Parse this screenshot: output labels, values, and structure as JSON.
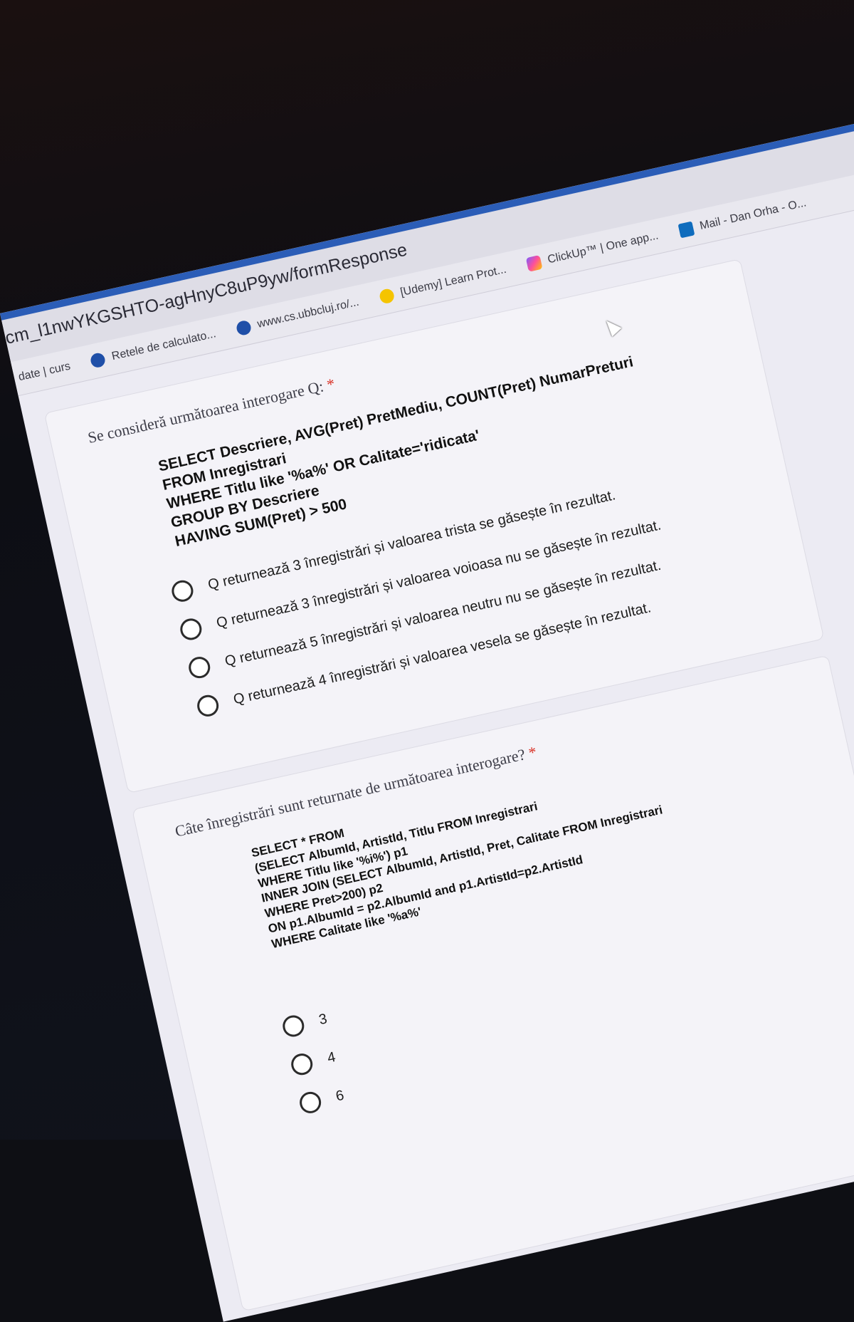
{
  "browser": {
    "url": "cm_l1nwYKGSHTO-agHnyC8uP9yw/formResponse",
    "bookmarks": [
      {
        "label": "date | curs",
        "icon": "none"
      },
      {
        "label": "Retele de calculato...",
        "icon": "site-icon"
      },
      {
        "label": "www.cs.ubbcluj.ro/...",
        "icon": "site-icon"
      },
      {
        "label": "[Udemy] Learn Prot...",
        "icon": "udemy-icon"
      },
      {
        "label": "ClickUp™ | One app...",
        "icon": "clickup-icon"
      },
      {
        "label": "Mail - Dan Orha - O...",
        "icon": "outlook-icon"
      }
    ]
  },
  "question1": {
    "label": "Se consideră următoarea interogare Q:",
    "required": "*",
    "sql": [
      "SELECT Descriere, AVG(Pret) PretMediu, COUNT(Pret) NumarPreturi",
      "FROM Inregistrari",
      "WHERE Titlu like '%a%' OR Calitate='ridicata'",
      "GROUP BY Descriere",
      "HAVING SUM(Pret) > 500"
    ],
    "options": [
      "Q returnează 3 înregistrări și valoarea trista se găsește în rezultat.",
      "Q returnează 3 înregistrări și valoarea voioasa nu se găsește în rezultat.",
      "Q returnează 5 înregistrări și valoarea neutru nu se găsește în rezultat.",
      "Q returnează 4 înregistrări și valoarea vesela se găsește în rezultat."
    ]
  },
  "question2": {
    "label": "Câte înregistrări sunt returnate de următoarea interogare?",
    "required": "*",
    "sql": [
      "SELECT * FROM",
      "(SELECT AlbumId, ArtistId, Titlu FROM Inregistrari",
      "WHERE Titlu like '%i%') p1",
      "INNER JOIN (SELECT AlbumId, ArtistId, Pret, Calitate FROM Inregistrari",
      "WHERE Pret>200) p2",
      "ON p1.AlbumId = p2.AlbumId and p1.ArtistId=p2.ArtistId",
      "WHERE Calitate like '%a%'"
    ],
    "options": [
      "3",
      "4",
      "6"
    ]
  }
}
